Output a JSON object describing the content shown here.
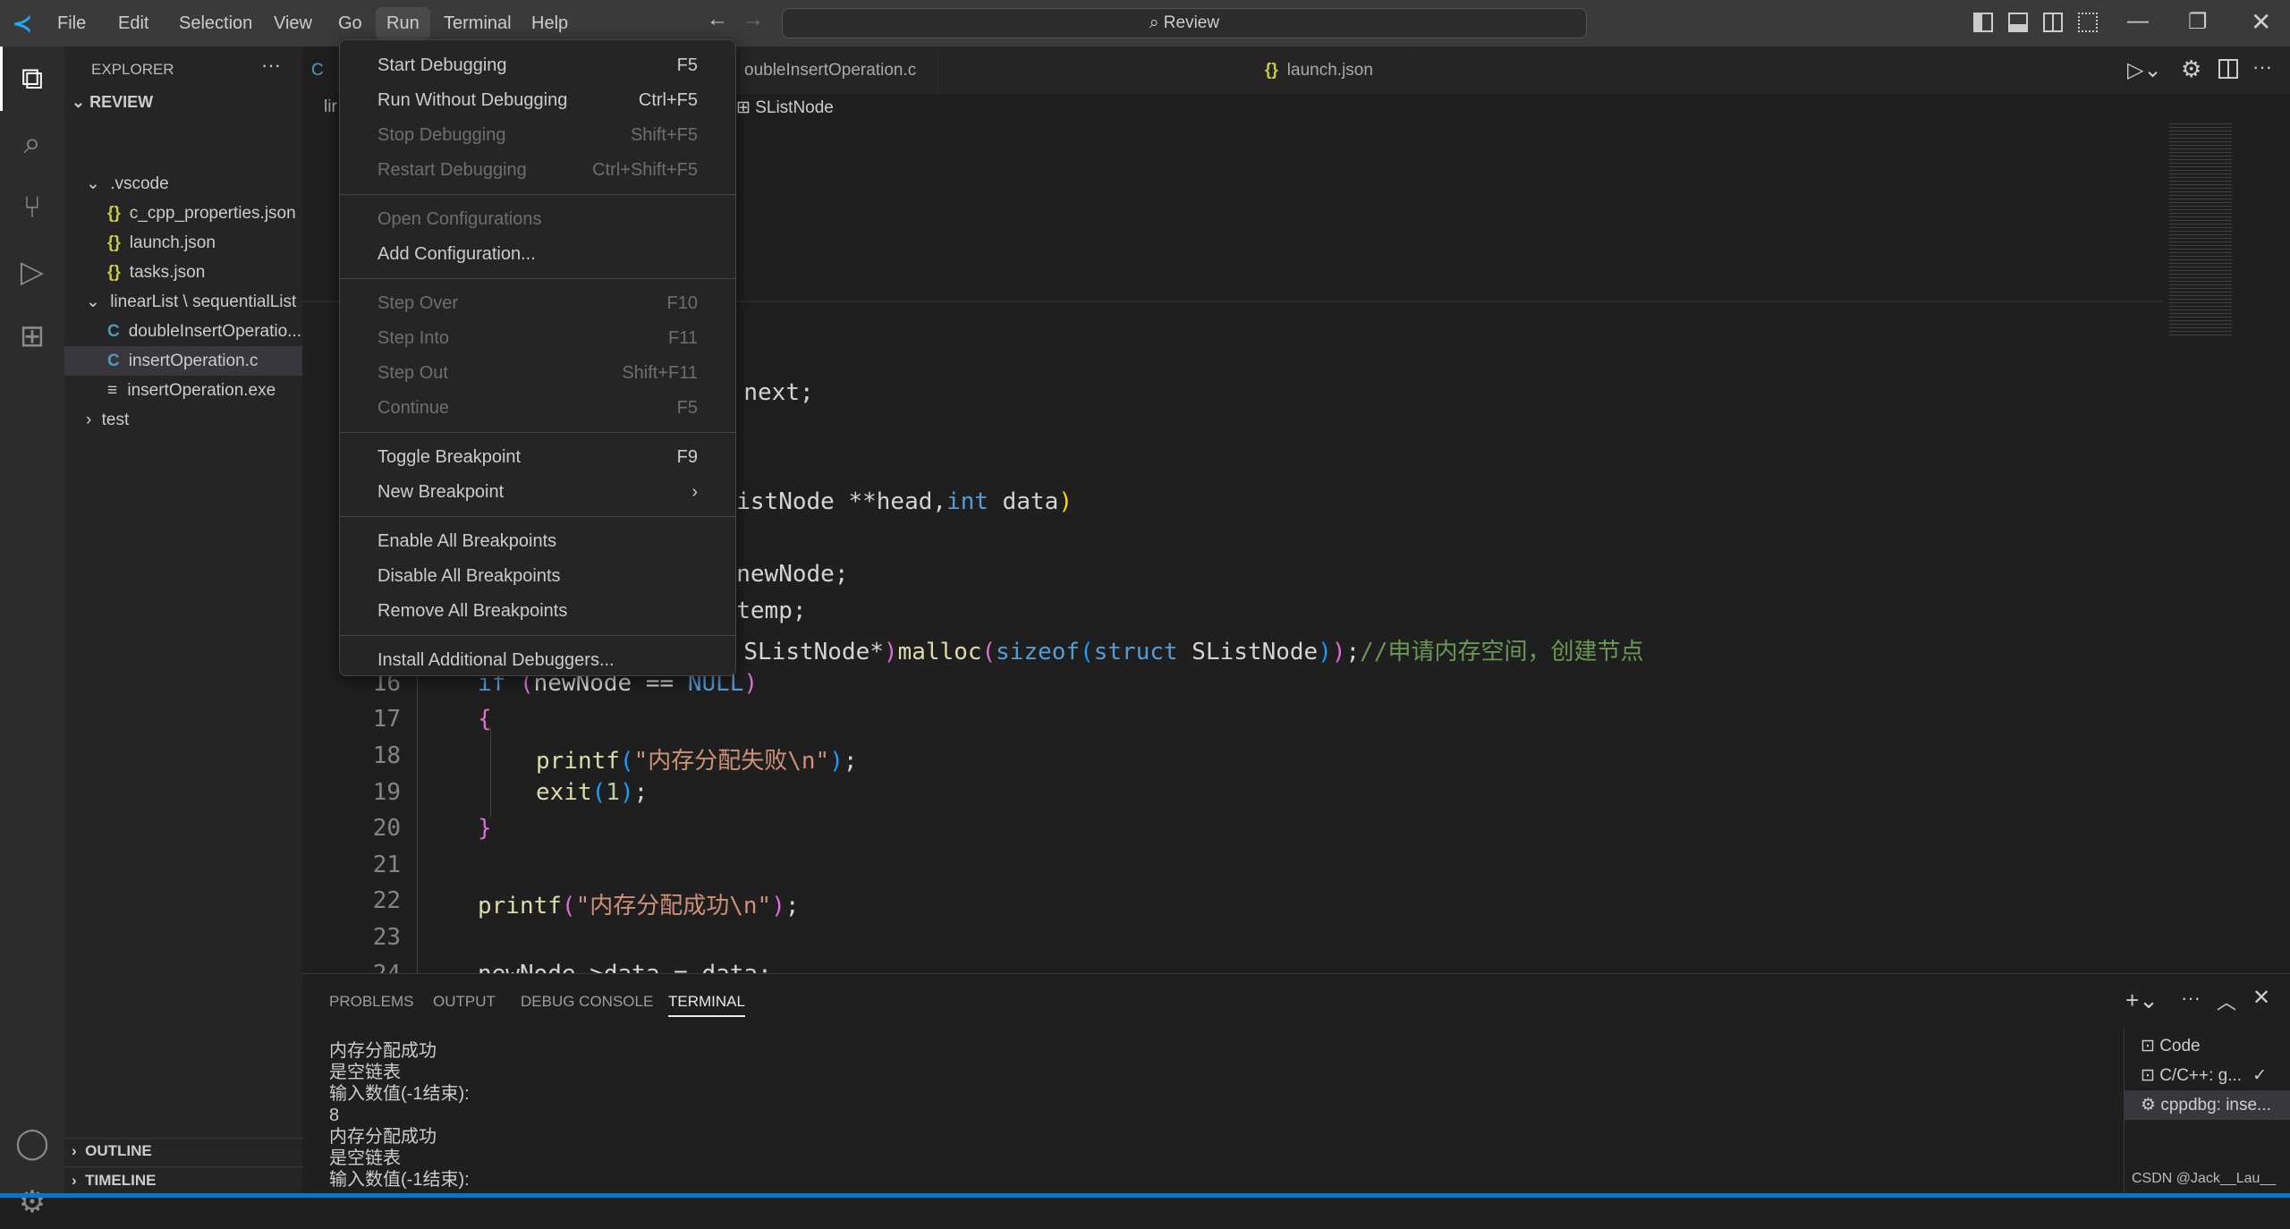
{
  "titlebar": {
    "menus": [
      "File",
      "Edit",
      "Selection",
      "View",
      "Go",
      "Run",
      "Terminal",
      "Help"
    ],
    "active_menu": "Run",
    "search": "Review"
  },
  "sidebar": {
    "title": "EXPLORER",
    "root": "REVIEW",
    "items": [
      {
        "label": ".vscode",
        "type": "folder-open"
      },
      {
        "label": "c_cpp_properties.json",
        "type": "json"
      },
      {
        "label": "launch.json",
        "type": "json"
      },
      {
        "label": "tasks.json",
        "type": "json"
      },
      {
        "label": "linearList \\ sequentialList",
        "type": "folder-open"
      },
      {
        "label": "doubleInsertOperatio...",
        "type": "c"
      },
      {
        "label": "insertOperation.c",
        "type": "c",
        "selected": true
      },
      {
        "label": "insertOperation.exe",
        "type": "exe"
      },
      {
        "label": "test",
        "type": "folder-closed"
      }
    ],
    "outline": "OUTLINE",
    "timeline": "TIMELINE"
  },
  "tabs": [
    {
      "label": "oubleInsertOperation.c"
    },
    {
      "label": "launch.json"
    }
  ],
  "breadcrumb": {
    "start": "lir",
    "symbol": "SListNode"
  },
  "run_menu": {
    "items": [
      {
        "label": "Start Debugging",
        "shortcut": "F5",
        "enabled": true
      },
      {
        "label": "Run Without Debugging",
        "shortcut": "Ctrl+F5",
        "enabled": true
      },
      {
        "label": "Stop Debugging",
        "shortcut": "Shift+F5",
        "enabled": false
      },
      {
        "label": "Restart Debugging",
        "shortcut": "Ctrl+Shift+F5",
        "enabled": false
      },
      {
        "sep": true
      },
      {
        "label": "Open Configurations",
        "shortcut": "",
        "enabled": false
      },
      {
        "label": "Add Configuration...",
        "shortcut": "",
        "enabled": true
      },
      {
        "sep": true
      },
      {
        "label": "Step Over",
        "shortcut": "F10",
        "enabled": false
      },
      {
        "label": "Step Into",
        "shortcut": "F11",
        "enabled": false
      },
      {
        "label": "Step Out",
        "shortcut": "Shift+F11",
        "enabled": false
      },
      {
        "label": "Continue",
        "shortcut": "F5",
        "enabled": false
      },
      {
        "sep": true
      },
      {
        "label": "Toggle Breakpoint",
        "shortcut": "F9",
        "enabled": true
      },
      {
        "label": "New Breakpoint",
        "shortcut": "›",
        "enabled": true
      },
      {
        "sep": true
      },
      {
        "label": "Enable All Breakpoints",
        "shortcut": "",
        "enabled": true
      },
      {
        "label": "Disable All Breakpoints",
        "shortcut": "",
        "enabled": true
      },
      {
        "label": "Remove All Breakpoints",
        "shortcut": "",
        "enabled": true
      },
      {
        "sep": true
      },
      {
        "label": "Install Additional Debuggers...",
        "shortcut": "",
        "enabled": true
      }
    ]
  },
  "code": {
    "l8": "next;",
    "l11a": "istNode **head,",
    "l11b": "int",
    "l11c": " data",
    "l13": "newNode;",
    "l14": "temp;",
    "l15a": "SListNode*",
    "l15b": "malloc",
    "l15c": "sizeof",
    "l15d": "struct",
    "l15e": " SListNode",
    "l15f": "//申请内存空间，创建节点",
    "l16a": "if",
    "l16b": "newNode == ",
    "l16c": "NULL",
    "l18a": "printf",
    "l18b": "\"内存分配失败\\n\"",
    "l19a": "exit",
    "l19b": "1",
    "l22a": "printf",
    "l22b": "\"内存分配成功\\n\"",
    "l24": "newNode->data = data;",
    "line_numbers": [
      "16",
      "17",
      "18",
      "19",
      "20",
      "21",
      "22",
      "23",
      "24"
    ]
  },
  "panel": {
    "tabs": [
      "PROBLEMS",
      "OUTPUT",
      "DEBUG CONSOLE",
      "TERMINAL"
    ],
    "active": "TERMINAL",
    "terminal_lines": [
      "内存分配成功",
      "是空链表",
      "输入数值(-1结束):",
      "8",
      "内存分配成功",
      "是空链表",
      "输入数值(-1结束):"
    ],
    "terminals": [
      {
        "label": "Code"
      },
      {
        "label": "C/C++: g...",
        "check": "✓"
      },
      {
        "label": "cppdbg: inse..."
      }
    ]
  },
  "watermark": "CSDN @Jack__Lau__",
  "colors": {
    "accent": "#007acc",
    "json_icon": "#cbcb41",
    "c_icon": "#519aba"
  }
}
